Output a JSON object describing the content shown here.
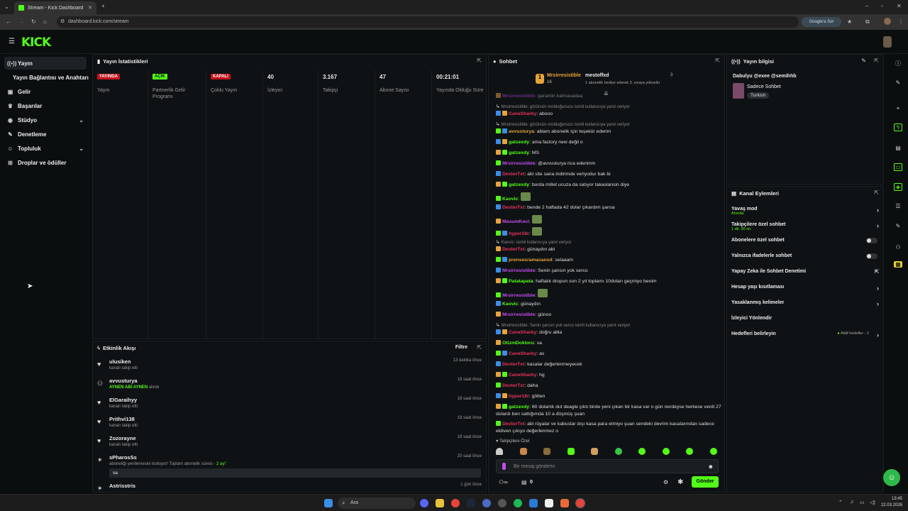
{
  "browser": {
    "tab_title": "Stream - Kick Dashboard",
    "url": "dashboard.kick.com/stream",
    "google_button": "Google'a Sor"
  },
  "header": {
    "logo": "KICK"
  },
  "sidebar": {
    "items": [
      {
        "label": "Yayın",
        "icon": "broadcast-icon"
      },
      {
        "label": "Yayın Bağlantısı ve Anahtarı",
        "icon": ""
      },
      {
        "label": "Gelir",
        "icon": "wallet-icon"
      },
      {
        "label": "Başarılar",
        "icon": "trophy-icon"
      },
      {
        "label": "Stüdyo",
        "icon": "palette-icon"
      },
      {
        "label": "Denetleme",
        "icon": "wrench-icon"
      },
      {
        "label": "Topluluk",
        "icon": "community-icon"
      },
      {
        "label": "Droplar ve ödüller",
        "icon": "gift-icon"
      }
    ]
  },
  "stats": {
    "title": "Yayın İstatistikleri",
    "columns": [
      {
        "value": "YAYINDA",
        "label": "Yayın",
        "kind": "red"
      },
      {
        "value": "AÇIK",
        "label": "Partnerlik Gelir Programı",
        "kind": "green"
      },
      {
        "value": "KAPALI",
        "label": "Çoklu Yayın",
        "kind": "red"
      },
      {
        "value": "40",
        "label": "İzleyici",
        "kind": "num"
      },
      {
        "value": "3.167",
        "label": "Takipçi",
        "kind": "num"
      },
      {
        "value": "47",
        "label": "Abone Sayısı",
        "kind": "num"
      },
      {
        "value": "00:21:01",
        "label": "Yayında Olduğu Süre",
        "kind": "num"
      }
    ]
  },
  "activity": {
    "title": "Etkinlik Akışı",
    "filter": "Filtre",
    "events": [
      {
        "name": "ulusiken",
        "sub": "kanalı takip etti",
        "time": "13 dakika önce",
        "icon": "heart-icon"
      },
      {
        "name": "avvusturya",
        "sub": "AYNEN ABİ AYNEN",
        "sub2": "alındı",
        "time": "18 saat önce",
        "icon": "gift-icon"
      },
      {
        "name": "ElGaraihyy",
        "sub": "kanalı takip etti",
        "time": "18 saat önce",
        "icon": "heart-icon"
      },
      {
        "name": "Prithvi138",
        "sub": "kanalı takip etti",
        "time": "19 saat önce",
        "icon": "heart-icon"
      },
      {
        "name": "Zozorayne",
        "sub": "kanalı takip etti",
        "time": "19 saat önce",
        "icon": "heart-icon"
      },
      {
        "name": "sPharosSs",
        "sub": "aboneliği yenilemesini kutluyor! Toplam abonelik süresi -",
        "sub_hl": "2 ay!",
        "msg": "sa",
        "time": "20 saat önce",
        "icon": "star-icon"
      },
      {
        "name": "Astrisstris",
        "time": "1 gün önce",
        "icon": "star-icon"
      }
    ]
  },
  "chat": {
    "title": "Sohbet",
    "pinned": {
      "user1": "Mrsirresistible",
      "count1": "16",
      "user2": "mestoffxd",
      "count2": "3",
      "note": "1 abonelik hediye ederek 3. sıraya yükselin"
    },
    "lines": [
      {
        "user": "Mrsirresistible",
        "color": "#c44cf2",
        "text": "garantin kalmasadaa",
        "faded": true
      },
      {
        "reply": "Mrsirresistible: görürsün molduğunuzu isimli kullanıcıya yanıt veriyor"
      },
      {
        "user": "CaneSharky",
        "color": "#e8335c",
        "text": "abooo"
      },
      {
        "reply": "Mrsirresistible: görürsün molduğunuzu isimli kullanıcıya yanıt veriyor"
      },
      {
        "user": "avvusturya",
        "color": "#e8a33a",
        "text": "ablam abonelik için teşekür ederim"
      },
      {
        "user": "gatzexdy",
        "color": "#53fc18",
        "text": "ama factory new değil o"
      },
      {
        "user": "gatzexdy",
        "color": "#53fc18",
        "text": "MS"
      },
      {
        "user": "Mrsirresistible",
        "color": "#c44cf2",
        "text": "@avvusturya rica ederimm"
      },
      {
        "user": "DexterTxt",
        "color": "#e8335c",
        "text": "abi site sana indirimde veriyodur bak bi"
      },
      {
        "user": "gatzexdy",
        "color": "#53fc18",
        "text": "burda millet ucuza da satıyor takaslansin diye"
      },
      {
        "user": "Kaovic",
        "color": "#53fc18",
        "text": ""
      },
      {
        "user": "DexterTxt",
        "color": "#e8335c",
        "text": "bende 2 haftada 42 dolar çıkardım şansa"
      },
      {
        "user": "MasumKeci",
        "color": "#c44cf2",
        "text": ""
      },
      {
        "user": "hyper18r",
        "color": "#e8335c",
        "text": ""
      },
      {
        "reply": "Kaovic: isimli kullanıcıya yanıt veriyor"
      },
      {
        "user": "DexterTxt",
        "color": "#e8335c",
        "text": "günaydın abi"
      },
      {
        "user": "prensesramazanxd",
        "color": "#e8a33a",
        "text": "selaaam"
      },
      {
        "user": "Mrsirresistible",
        "color": "#c44cf2",
        "text": "Senin şansın yok serco"
      },
      {
        "user": "Patatapata",
        "color": "#53fc18",
        "text": "haftalık dropun son 2 yıl toplamı 10doları geçmiyo benim"
      },
      {
        "user": "Mrsirresistible",
        "color": "#c44cf2",
        "text": ""
      },
      {
        "user": "Kaovic",
        "color": "#53fc18",
        "text": "günaydın"
      },
      {
        "user": "Mrsirresistible",
        "color": "#c44cf2",
        "text": "günoo"
      },
      {
        "reply": "Mrsirresistible: Senin şansın yok serco isimli kullanıcıya yanıt veriyor"
      },
      {
        "user": "CaneSharky",
        "color": "#e8335c",
        "text": "doğru abla"
      },
      {
        "user": "OtizmDoktoru",
        "color": "#53fc18",
        "text": "sa"
      },
      {
        "user": "CaneSharky",
        "color": "#e8335c",
        "text": "as"
      },
      {
        "user": "DexterTxt",
        "color": "#e8335c",
        "text": "kasalar değerlenmeyecek"
      },
      {
        "user": "CaneSharky",
        "color": "#e8335c",
        "text": "hg"
      },
      {
        "user": "DexterTxt",
        "color": "#e8335c",
        "text": "daha"
      },
      {
        "user": "hyper18r",
        "color": "#e8335c",
        "text": "götten"
      },
      {
        "user": "gatzexdy",
        "color": "#53fc18",
        "text": "60 dolarlık dut deagle çıktı birde yeni çıkan bir kasa var o gün nerdeyse herkese verdi 27 dolardı ben sattığımda 10 a düşmüş şuan"
      },
      {
        "user": "DexterTxt",
        "color": "#e8335c",
        "text": "abi rüyalar ve kabuslar dışı kasa para etmiyo şuan sendeki devrim kasalarından sadece eldiven çıkıyo değerlenmez o"
      }
    ],
    "followers_only": "Takipçilere Özel",
    "input_placeholder": "Bir mesaj gönderin",
    "points": "0",
    "send_label": "Gönder"
  },
  "stream_info": {
    "title": "Yayın bilgisi",
    "stream_title": "Dabulyu @exee @semihhb",
    "category": "Sadece Sohbet",
    "tag": "Turkish"
  },
  "channel_actions": {
    "title": "Kanal Eylemleri",
    "items": [
      {
        "label": "Yavaş mod",
        "sub": "Anında",
        "ctrl": "chevron"
      },
      {
        "label": "Takipçilere özel sohbet",
        "sub": "1 dk. 30 sn.",
        "ctrl": "chevron"
      },
      {
        "label": "Abonelere özel sohbet",
        "ctrl": "toggle"
      },
      {
        "label": "Yalnızca ifadelerle sohbet",
        "ctrl": "toggle"
      },
      {
        "label": "Yapay Zeka ile Sohbet Denetimi",
        "ctrl": "link"
      },
      {
        "label": "Hesap yaşı kısıtlaması",
        "ctrl": "chevron"
      },
      {
        "label": "Yasaklanmış kelimeler",
        "ctrl": "chevron"
      },
      {
        "label": "İzleyici Yönlendir",
        "ctrl": "none"
      },
      {
        "label": "Hedefleri belirleyin",
        "extra": "Aktif hedefler - 2",
        "ctrl": "chevron"
      }
    ]
  },
  "taskbar": {
    "search": "Ara",
    "time": "13:45",
    "date": "22.03.2026"
  },
  "colors": {
    "accent": "#53fc18",
    "live": "#c4121c",
    "bg": "#0b0e0f"
  }
}
